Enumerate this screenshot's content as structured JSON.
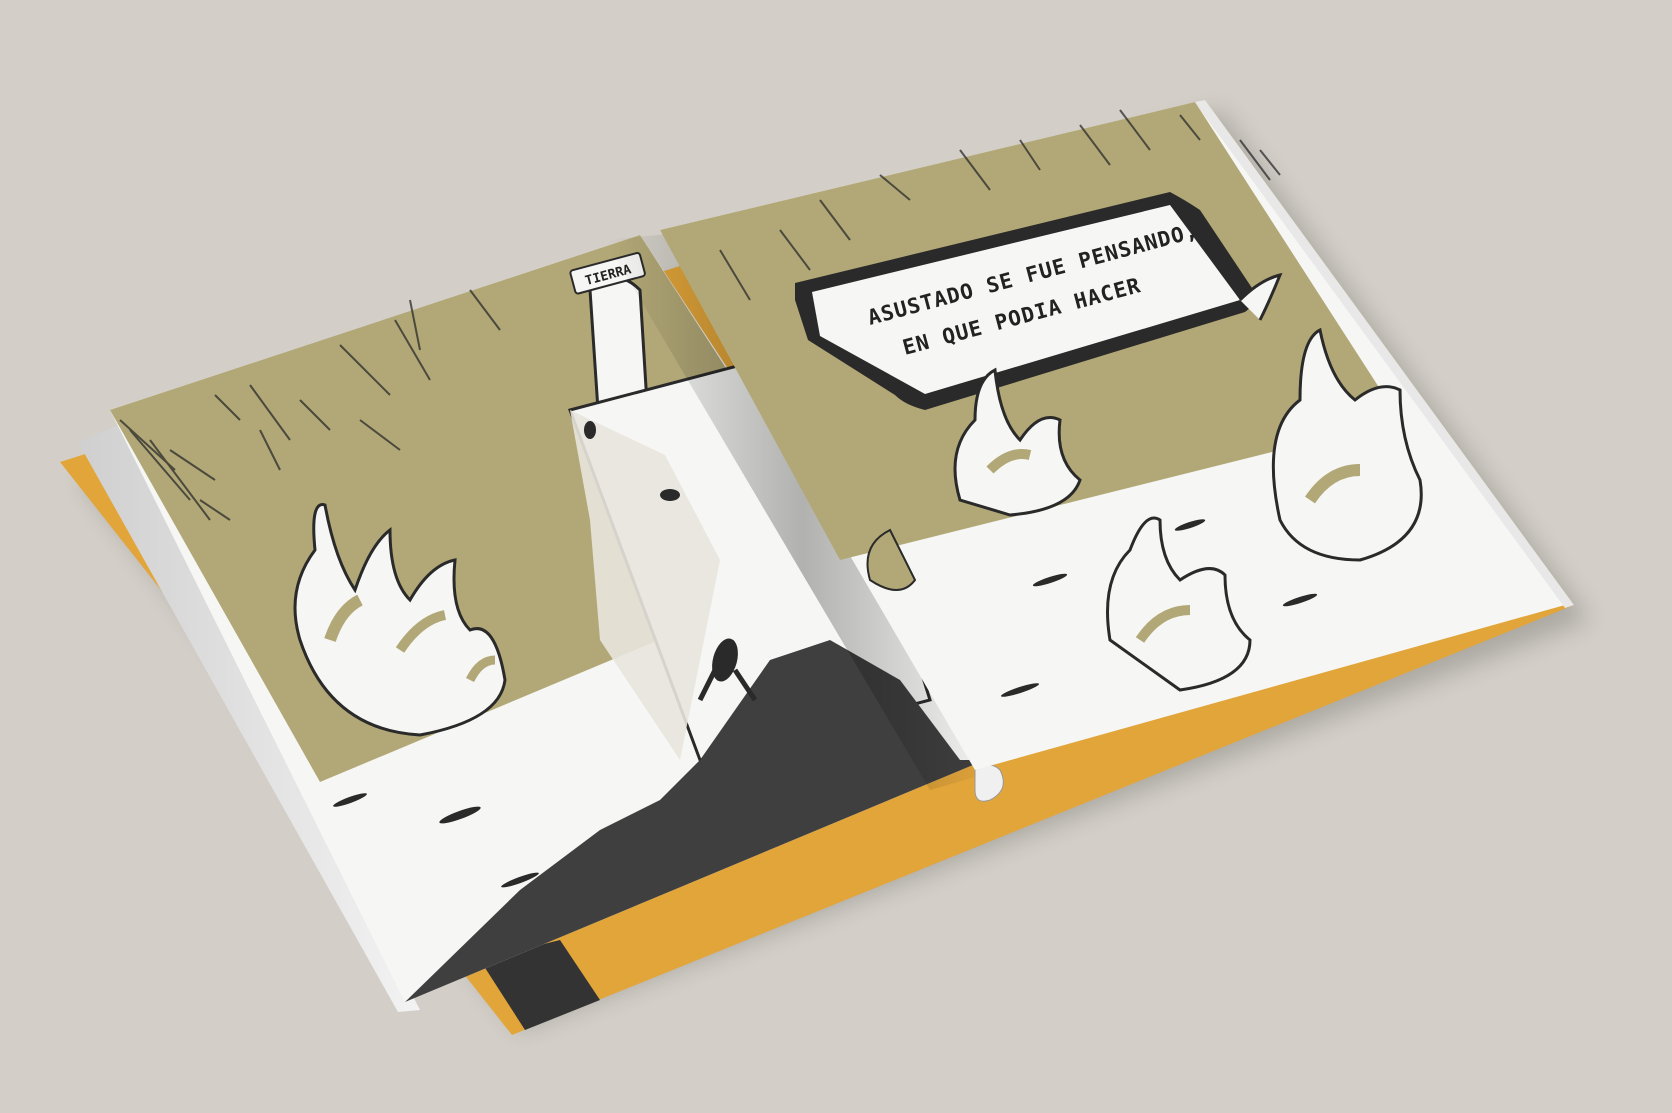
{
  "scene": {
    "description_label": "open-picture-book",
    "colors": {
      "background": "#d3cfc8",
      "cover": "#e2a53a",
      "page_tint": "#b2a877",
      "ink": "#2a2a2a",
      "paper": "#f6f6f4",
      "shadow_block": "#3f3f40"
    }
  },
  "left_page": {
    "tower_tab_text": "TIERRA"
  },
  "right_page": {
    "sign_lines": [
      "ASUSTADO SE FUE PENSANDO,",
      "EN QUE PODIA HACER"
    ]
  }
}
